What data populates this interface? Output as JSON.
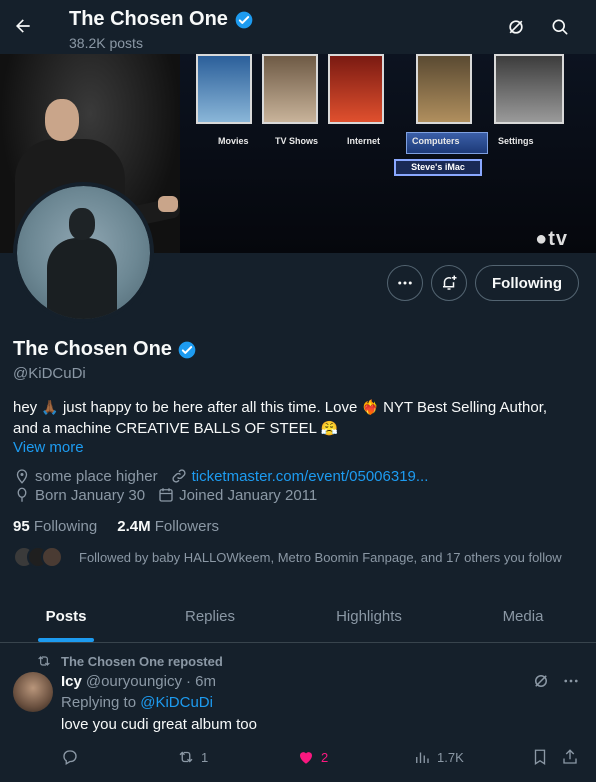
{
  "header": {
    "title": "The Chosen One",
    "posts_count": "38.2K posts"
  },
  "banner": {
    "menu": [
      "Movies",
      "TV Shows",
      "Internet",
      "Computers",
      "Settings"
    ],
    "submenu": "Steve's iMac",
    "brand": "tv"
  },
  "profile": {
    "name": "The Chosen One",
    "handle": "@KiDCuDi",
    "bio_part1": "hey",
    "bio_part2": "just happy to be here after all this time. Love",
    "bio_part3": "NYT Best Selling Author,",
    "bio_part4": "and a machine CREATIVE BALLS OF STEEL",
    "view_more": "View more",
    "location": "some place higher",
    "link": "ticketmaster.com/event/05006319...",
    "born": "Born January 30",
    "joined": "Joined January 2011",
    "following_count": "95",
    "following_label": "Following",
    "followers_count": "2.4M",
    "followers_label": "Followers",
    "followed_by": "Followed by baby HALLOWkeem, Metro Boomin Fanpage, and 17 others you follow"
  },
  "buttons": {
    "follow_state": "Following"
  },
  "tabs": [
    {
      "label": "Posts",
      "active": true
    },
    {
      "label": "Replies",
      "active": false
    },
    {
      "label": "Highlights",
      "active": false
    },
    {
      "label": "Media",
      "active": false
    }
  ],
  "tweet": {
    "repost_label": "The Chosen One reposted",
    "author_name": "Icy",
    "author_handle": "@ouryoungicy",
    "time": "· 6m",
    "replying_prefix": "Replying to",
    "replying_to": "@KiDCuDi",
    "text": "love you cudi great album too",
    "reposts": "1",
    "likes": "2",
    "views": "1.7K"
  },
  "colors": {
    "background": "#15202b",
    "accent": "#1d9bf0",
    "like": "#f91880",
    "muted": "#8b98a5"
  }
}
